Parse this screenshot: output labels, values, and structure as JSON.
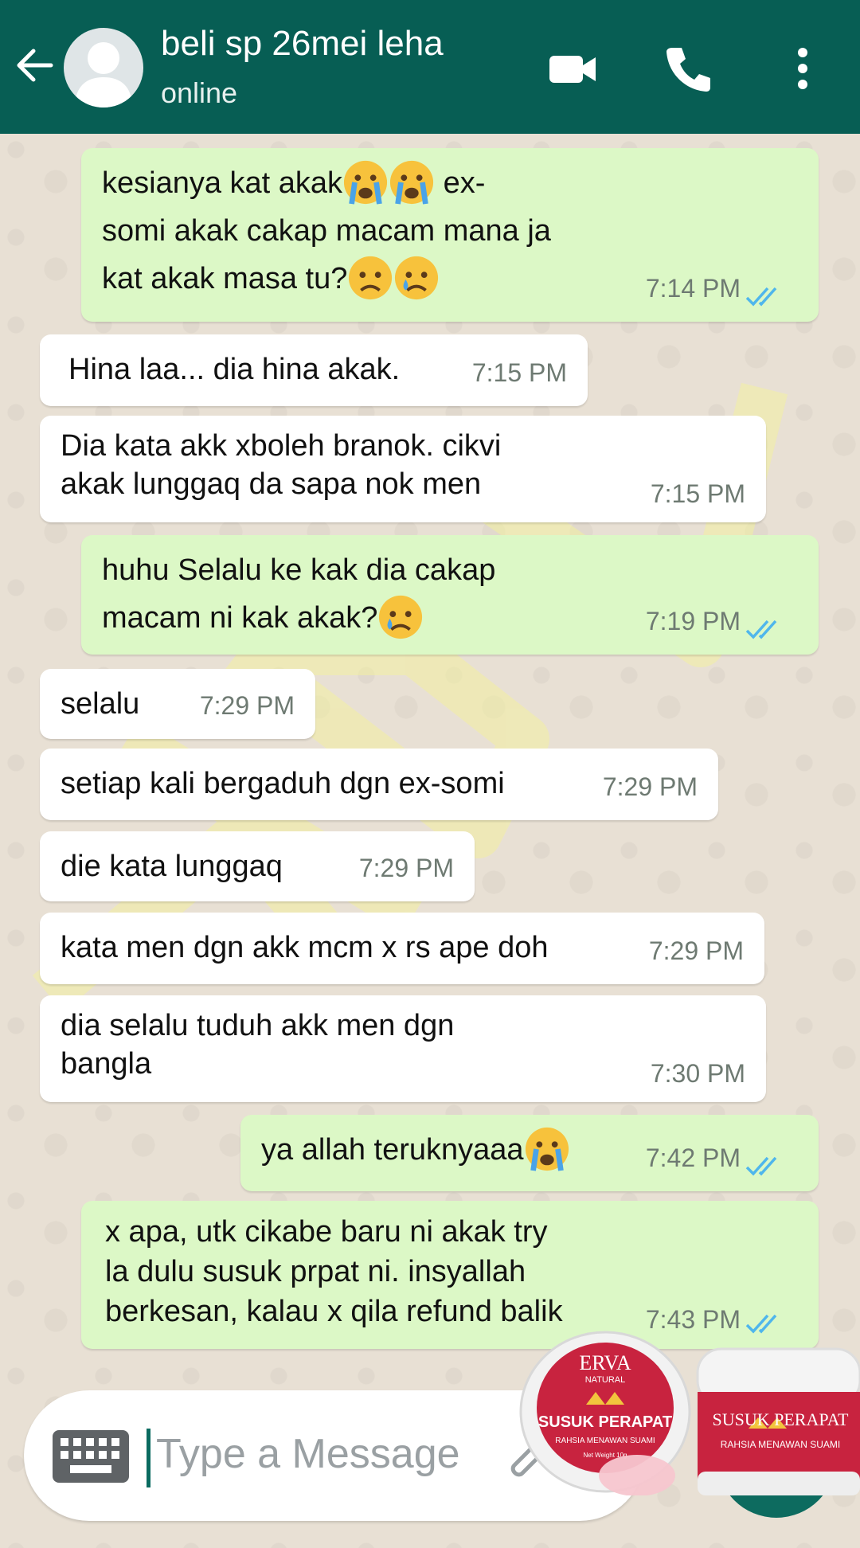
{
  "header": {
    "title": "beli sp 26mei leha",
    "status": "online",
    "colors": {
      "bar": "#075e54"
    }
  },
  "messages": [
    {
      "dir": "out",
      "text": "kesianya kat akak",
      "emoji_after": [
        "crying-face",
        "crying-face"
      ],
      "text2": " ex-\nsomi akak cakap macam mana ja\nkat akak masa tu?",
      "emoji_end": [
        "sad-face",
        "tear-face"
      ],
      "time": "7:14 PM",
      "read": true
    },
    {
      "dir": "in",
      "text": "Hina laa... dia hina akak.",
      "time": "7:15 PM"
    },
    {
      "dir": "in",
      "text": "Dia kata akk xboleh branok. cikvi\nakak lunggaq da sapa nok men",
      "time": "7:15 PM"
    },
    {
      "dir": "out",
      "text": "huhu Selalu ke kak dia cakap\nmacam ni kak akak?",
      "emoji_end": [
        "tear-face"
      ],
      "time": "7:19 PM",
      "read": true
    },
    {
      "dir": "in",
      "text": "selalu",
      "time": "7:29 PM"
    },
    {
      "dir": "in",
      "text": "setiap kali bergaduh dgn ex-somi",
      "time": "7:29 PM"
    },
    {
      "dir": "in",
      "text": "die kata lunggaq",
      "time": "7:29 PM"
    },
    {
      "dir": "in",
      "text": "kata men dgn akk mcm x rs ape doh",
      "time": "7:29 PM"
    },
    {
      "dir": "in",
      "text": "dia selalu tuduh akk men dgn\nbangla",
      "time": "7:30 PM"
    },
    {
      "dir": "out",
      "text": "ya allah teruknyaaa",
      "emoji_end": [
        "crying-face"
      ],
      "time": "7:42 PM",
      "read": true
    },
    {
      "dir": "out",
      "text": "x apa, utk cikabe baru ni akak try\nla dulu susuk prpat ni. insyallah\nberkesan, kalau x qila refund balik",
      "time": "7:43 PM",
      "read": true
    }
  ],
  "input": {
    "placeholder": "Type a Message"
  },
  "watermark": "ERVA",
  "product": {
    "brand": "ERVA",
    "brand_sub": "NATURAL",
    "name": "SUSUK PERAPAT",
    "tagline": "RAHSIA MENAWAN SUAMI",
    "weight": "Net Weight 10g"
  }
}
